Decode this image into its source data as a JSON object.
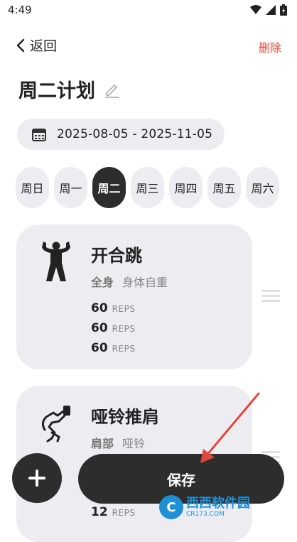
{
  "status_bar": {
    "time": "4:49"
  },
  "nav": {
    "back_label": "返回",
    "delete_label": "删除"
  },
  "page": {
    "title": "周二计划"
  },
  "date_range": {
    "text": "2025-08-05 - 2025-11-05"
  },
  "day_tabs": [
    {
      "label": "周日",
      "active": false
    },
    {
      "label": "周一",
      "active": false
    },
    {
      "label": "周二",
      "active": true
    },
    {
      "label": "周三",
      "active": false
    },
    {
      "label": "周四",
      "active": false
    },
    {
      "label": "周五",
      "active": false
    },
    {
      "label": "周六",
      "active": false
    }
  ],
  "exercises": [
    {
      "name": "开合跳",
      "body_part": "全身",
      "equipment": "身体自重",
      "icon": "jumping-jack-icon",
      "sets": [
        {
          "count": "60",
          "unit": "REPS"
        },
        {
          "count": "60",
          "unit": "REPS"
        },
        {
          "count": "60",
          "unit": "REPS"
        }
      ]
    },
    {
      "name": "哑铃推肩",
      "body_part": "肩部",
      "equipment": "哑铃",
      "icon": "dumbbell-press-icon",
      "sets": [
        {
          "count": "12",
          "unit": "REPS"
        }
      ]
    }
  ],
  "actions": {
    "save_label": "保存",
    "add_icon": "plus-icon"
  },
  "watermark": {
    "brand": "西西软件园",
    "url": "CR173.COM"
  },
  "colors": {
    "accent_red": "#e0483b",
    "dark": "#2d2d2d",
    "card_bg": "#ededf1",
    "arrow": "#e0483b"
  }
}
